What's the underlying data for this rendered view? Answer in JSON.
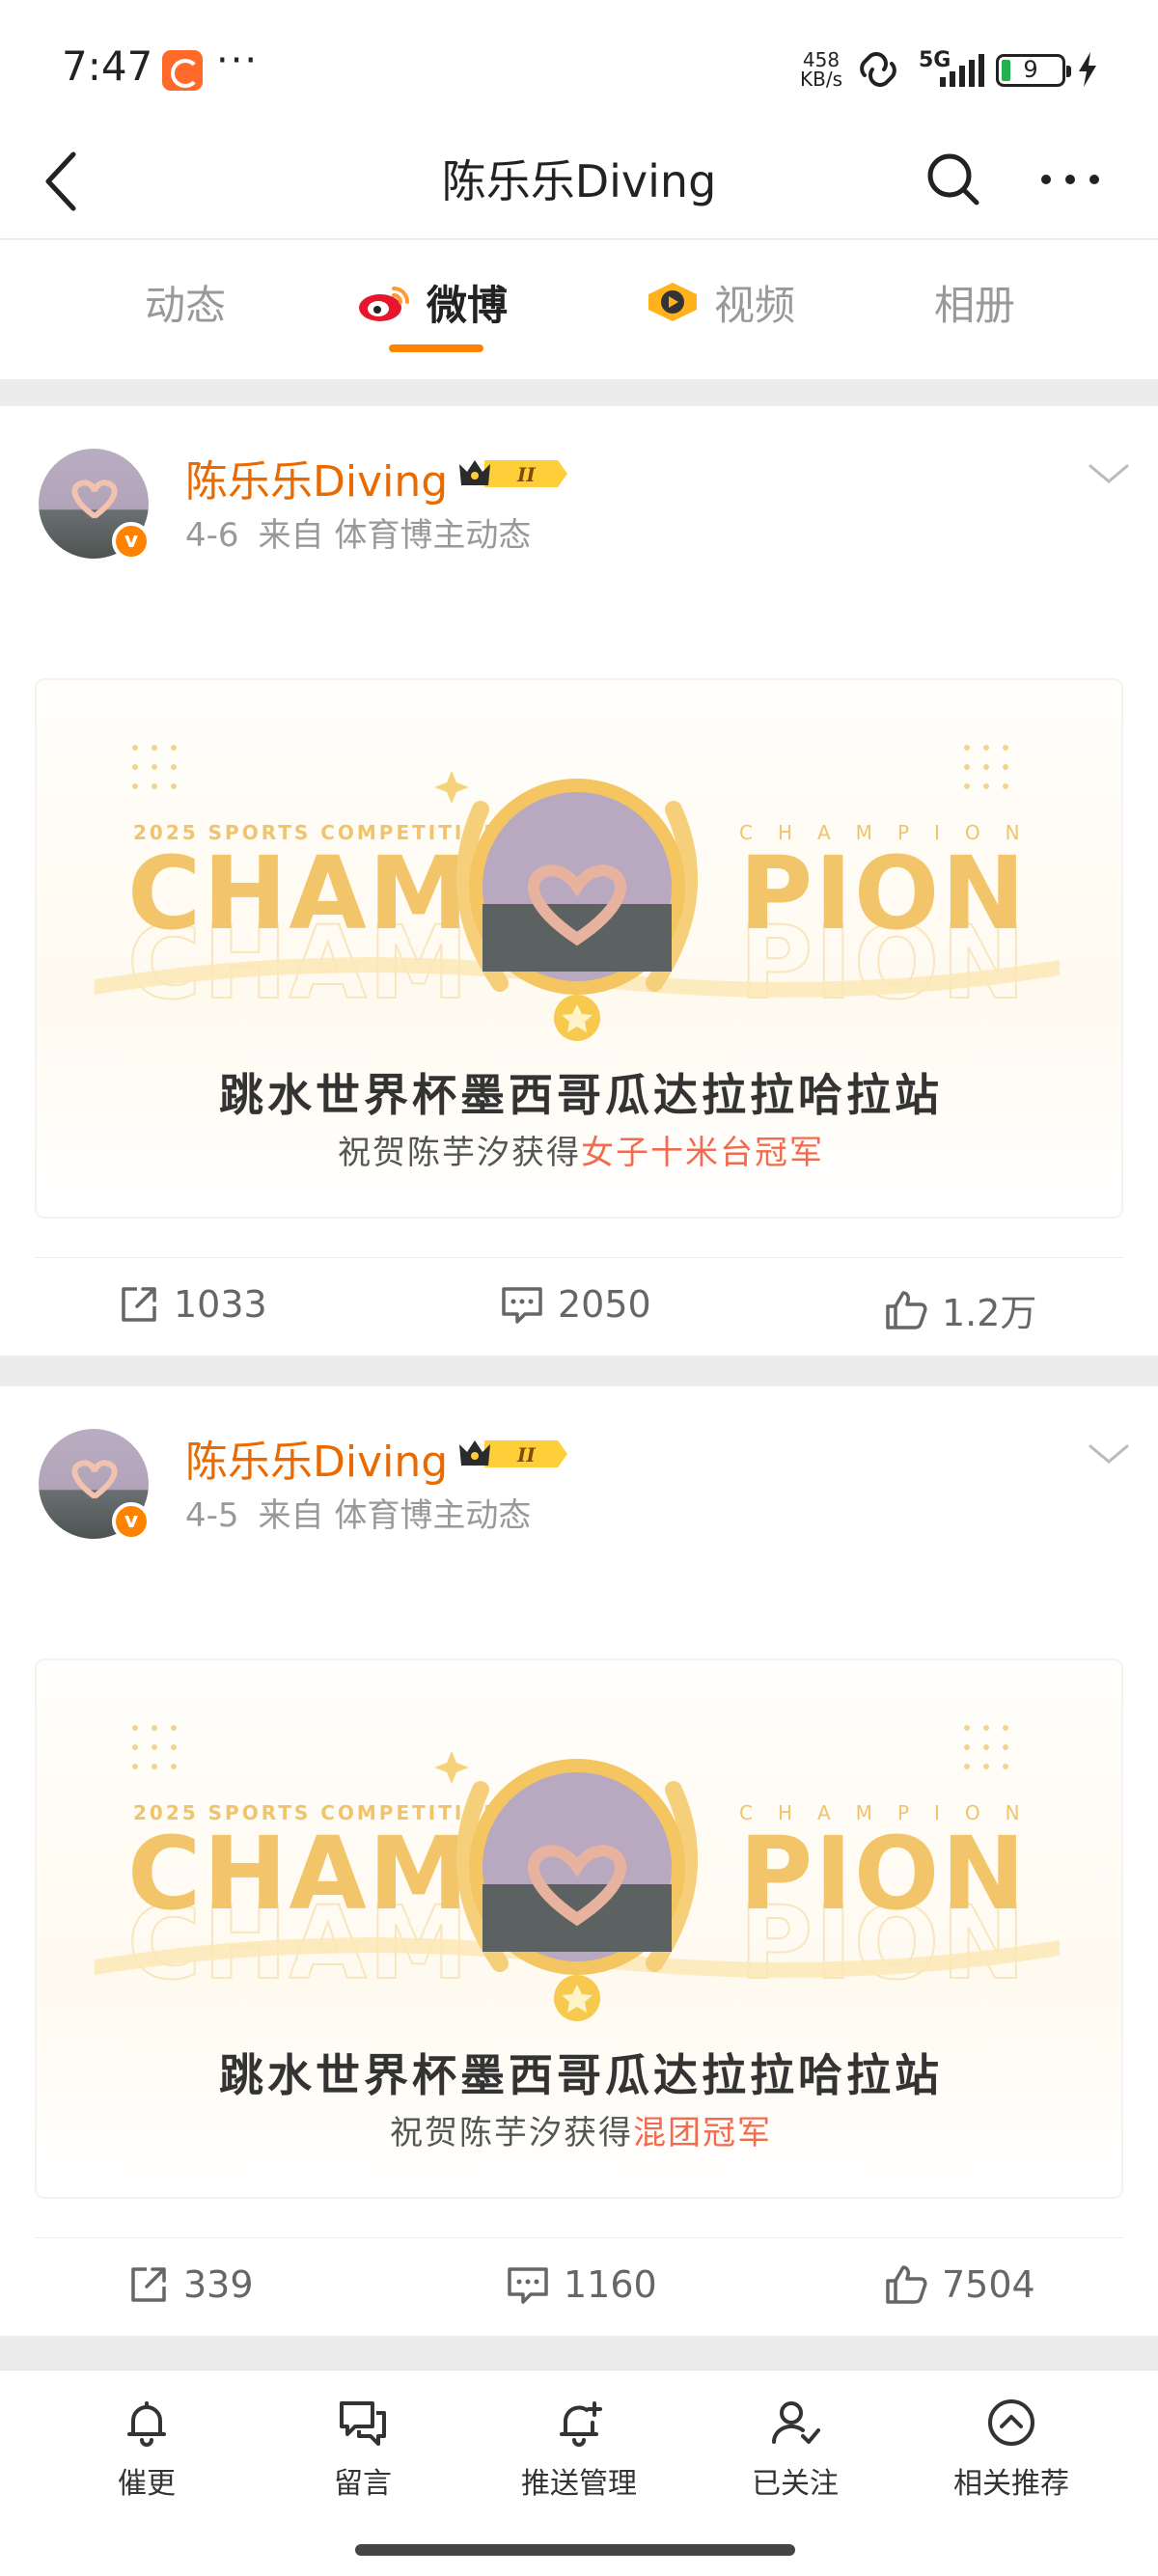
{
  "status_bar": {
    "time": "7:47",
    "network_speed_value": "458",
    "network_speed_unit": "KB/s",
    "signal_type": "5G",
    "battery_level": "9",
    "icons": [
      "app-notification-icon",
      "overflow-dots-icon",
      "hotspot-link-icon",
      "signal-bars-icon",
      "battery-icon",
      "charging-bolt-icon"
    ]
  },
  "nav": {
    "title": "陈乐乐Diving",
    "icons": [
      "back-chevron-icon",
      "search-icon",
      "more-dots-icon"
    ]
  },
  "tabs": [
    {
      "label": "动态",
      "active": false
    },
    {
      "label": "微博",
      "active": true,
      "icon": "weibo-logo-icon"
    },
    {
      "label": "视频",
      "active": false,
      "icon": "video-play-icon"
    },
    {
      "label": "相册",
      "active": false
    }
  ],
  "accent_color": "#ff8200",
  "author_color": "#e86a00",
  "posts": [
    {
      "author": "陈乐乐Diving",
      "badge_level": "II",
      "date": "4-6",
      "source": "来自 体育博主动态",
      "banner": {
        "small_left": "2025 SPORTS COMPETITION",
        "small_right": "CHAMPION",
        "word_left": "CHAM",
        "word_right": "PION",
        "title": "跳水世界杯墨西哥瓜达拉拉哈拉站",
        "sub_prefix": "祝贺陈芋汐获得",
        "sub_highlight": "女子十米台冠军"
      },
      "reposts": "1033",
      "comments": "2050",
      "likes": "1.2万"
    },
    {
      "author": "陈乐乐Diving",
      "badge_level": "II",
      "date": "4-5",
      "source": "来自 体育博主动态",
      "banner": {
        "small_left": "2025 SPORTS COMPETITION",
        "small_right": "CHAMPION",
        "word_left": "CHAM",
        "word_right": "PION",
        "title": "跳水世界杯墨西哥瓜达拉拉哈拉站",
        "sub_prefix": "祝贺陈芋汐获得",
        "sub_highlight": "混团冠军"
      },
      "reposts": "339",
      "comments": "1160",
      "likes": "7504"
    }
  ],
  "bottom_bar": [
    {
      "label": "催更",
      "icon": "bell-icon"
    },
    {
      "label": "留言",
      "icon": "message-bubbles-icon"
    },
    {
      "label": "推送管理",
      "icon": "bell-plus-icon"
    },
    {
      "label": "已关注",
      "icon": "user-check-icon"
    },
    {
      "label": "相关推荐",
      "icon": "chevron-up-circle-icon"
    }
  ]
}
